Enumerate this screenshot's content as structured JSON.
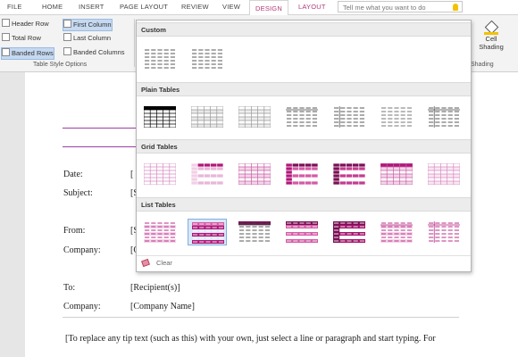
{
  "tabs": [
    "FILE",
    "HOME",
    "INSERT",
    "PAGE LAYOUT",
    "REVIEW",
    "VIEW",
    "DESIGN",
    "LAYOUT"
  ],
  "active_tab": "DESIGN",
  "tell_me_placeholder": "Tell me what you want to do",
  "table_style_options": {
    "header_row": "Header Row",
    "total_row": "Total Row",
    "banded_rows": "Banded Rows",
    "first_column": "First Column",
    "last_column": "Last Column",
    "banded_columns": "Banded Columns",
    "group_label": "Table Style Options"
  },
  "shading": {
    "button_label_1": "Cell",
    "button_label_2": "Shading",
    "group_label": "Shading"
  },
  "gallery": {
    "sections": [
      "Custom",
      "Plain Tables",
      "Grid Tables",
      "List Tables"
    ],
    "clear_label": "Clear",
    "accent": "#b0177a"
  },
  "document": {
    "date_label": "Date:",
    "subject_label": "Subject:",
    "from_label": "From:",
    "company_label": "Company:",
    "to_label": "To:",
    "to_value": "[Recipient(s)]",
    "company2_label": "Company:",
    "company2_value": "[Company Name]",
    "bracket_date": "[",
    "bracket_subject": "[S",
    "bracket_from": "[S",
    "bracket_company": "[C",
    "body_line_1": "[To replace any tip text (such as this) with your own, just select a line or paragraph and start typing. For"
  }
}
